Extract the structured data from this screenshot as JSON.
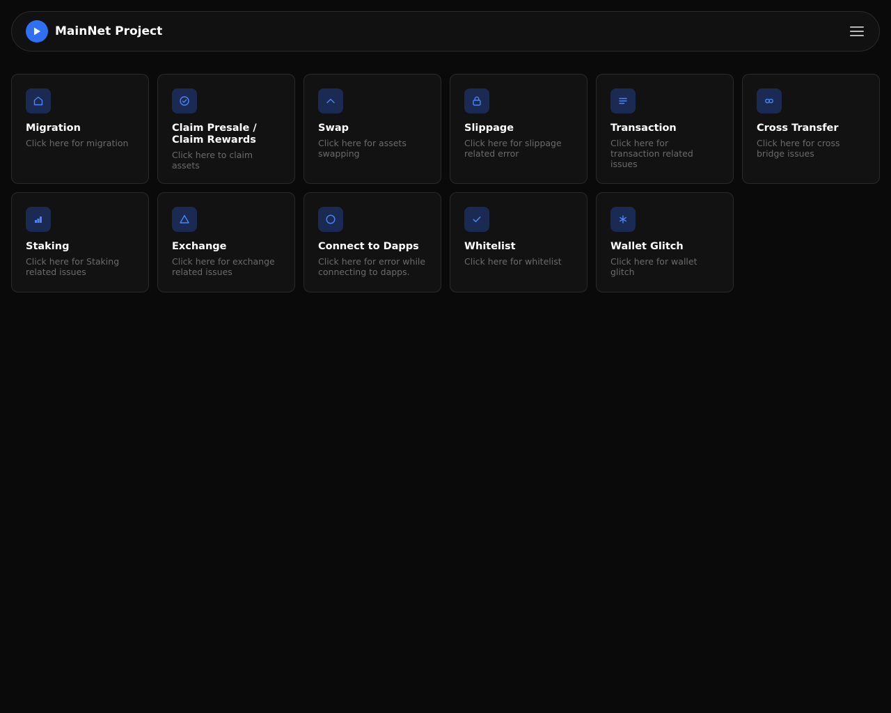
{
  "header": {
    "brand": "MainNet Project",
    "logo_icon": "play-icon",
    "menu_icon": "hamburger-menu-icon"
  },
  "colors": {
    "background": "#0a0a0a",
    "card": "#121212",
    "accent": "#2f6ff3",
    "icon_bg": "#1a2a52",
    "icon": "#4a86f7",
    "muted_text": "#6b6b6b"
  },
  "cards": [
    {
      "title": "Migration",
      "desc": "Click here for migration",
      "icon": "home-icon"
    },
    {
      "title": "Claim Presale / Claim Rewards",
      "desc": "Click here to claim assets",
      "icon": "check-circle-icon"
    },
    {
      "title": "Swap",
      "desc": "Click here for assets swapping",
      "icon": "chevron-up-icon"
    },
    {
      "title": "Slippage",
      "desc": "Click here for slippage related error",
      "icon": "lock-icon"
    },
    {
      "title": "Transaction",
      "desc": "Click here for transaction related issues",
      "icon": "lines-icon"
    },
    {
      "title": "Cross Transfer",
      "desc": "Click here for cross bridge issues",
      "icon": "infinity-icon"
    },
    {
      "title": "Staking",
      "desc": "Click here for Staking related issues",
      "icon": "bar-chart-icon"
    },
    {
      "title": "Exchange",
      "desc": "Click here for exchange related issues",
      "icon": "triangle-icon"
    },
    {
      "title": "Connect to Dapps",
      "desc": "Click here for error while connecting to dapps.",
      "icon": "circle-icon"
    },
    {
      "title": "Whitelist",
      "desc": "Click here for whitelist",
      "icon": "check-icon"
    },
    {
      "title": "Wallet Glitch",
      "desc": "Click here for wallet glitch",
      "icon": "sparkle-icon"
    }
  ]
}
